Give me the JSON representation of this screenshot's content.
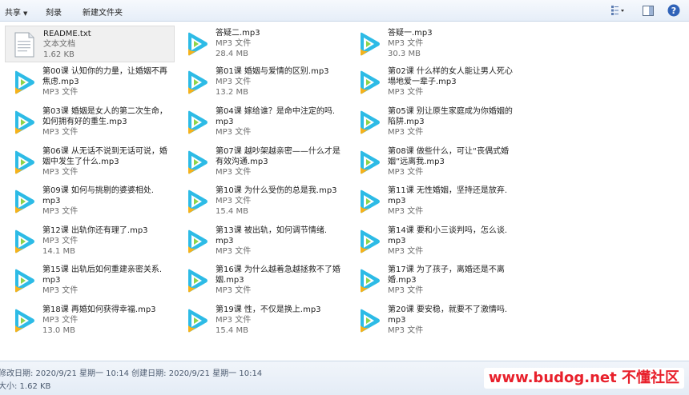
{
  "toolbar": {
    "share_label": "共享",
    "burn_label": "刻录",
    "new_folder_label": "新建文件夹",
    "view_options_icon": "view-list-icon",
    "preview_pane_icon": "preview-pane-icon",
    "help_icon": "help-icon"
  },
  "files": [
    {
      "name": "README.txt",
      "type": "文本文档",
      "size": "1.62 KB",
      "icon": "text-document-icon"
    },
    {
      "name": "答疑二.mp3",
      "type": "MP3 文件",
      "size": "28.4 MB",
      "icon": "media-player-icon"
    },
    {
      "name": "答疑一.mp3",
      "type": "MP3 文件",
      "size": "30.3 MB",
      "icon": "media-player-icon"
    },
    {
      "name": "第00课 认知你的力量，让婚姻不再\n焦虑.mp3",
      "type": "MP3 文件",
      "size": "",
      "icon": "media-player-icon"
    },
    {
      "name": "第01课 婚姻与爱情的区别.mp3",
      "type": "MP3 文件",
      "size": "13.2 MB",
      "icon": "media-player-icon"
    },
    {
      "name": "第02课 什么样的女人能让男人死心\n塌地爱一辈子.mp3",
      "type": "MP3 文件",
      "size": "",
      "icon": "media-player-icon"
    },
    {
      "name": "第03课 婚姻是女人的第二次生命，\n如何拥有好的重生.mp3",
      "type": "MP3 文件",
      "size": "",
      "icon": "media-player-icon"
    },
    {
      "name": "第04课 嫁给谁？是命中注定的吗.\nmp3",
      "type": "MP3 文件",
      "size": "",
      "icon": "media-player-icon"
    },
    {
      "name": "第05课 别让原生家庭成为你婚姻的\n陷阱.mp3",
      "type": "MP3 文件",
      "size": "",
      "icon": "media-player-icon"
    },
    {
      "name": "第06课 从无话不说到无话可说，婚\n姻中发生了什么.mp3",
      "type": "MP3 文件",
      "size": "",
      "icon": "media-player-icon"
    },
    {
      "name": "第07课 越吵架越亲密——什么才是\n有效沟通.mp3",
      "type": "MP3 文件",
      "size": "",
      "icon": "media-player-icon"
    },
    {
      "name": "第08课 做些什么，可让“丧偶式婚\n姻”远离我.mp3",
      "type": "MP3 文件",
      "size": "",
      "icon": "media-player-icon"
    },
    {
      "name": "第09课 如何与挑剔的婆婆相处.\nmp3",
      "type": "MP3 文件",
      "size": "",
      "icon": "media-player-icon"
    },
    {
      "name": "第10课 为什么受伤的总是我.mp3",
      "type": "MP3 文件",
      "size": "15.4 MB",
      "icon": "media-player-icon"
    },
    {
      "name": "第11课 无性婚姻，坚持还是放弃.\nmp3",
      "type": "MP3 文件",
      "size": "",
      "icon": "media-player-icon"
    },
    {
      "name": "第12课 出轨你还有理了.mp3",
      "type": "MP3 文件",
      "size": "14.1 MB",
      "icon": "media-player-icon"
    },
    {
      "name": "第13课 被出轨，如何调节情绪.\nmp3",
      "type": "MP3 文件",
      "size": "",
      "icon": "media-player-icon"
    },
    {
      "name": "第14课 要和小三谈判吗，怎么谈.\nmp3",
      "type": "MP3 文件",
      "size": "",
      "icon": "media-player-icon"
    },
    {
      "name": "第15课 出轨后如何重建亲密关系.\nmp3",
      "type": "MP3 文件",
      "size": "",
      "icon": "media-player-icon"
    },
    {
      "name": "第16课 为什么越着急越拯救不了婚\n姻.mp3",
      "type": "MP3 文件",
      "size": "",
      "icon": "media-player-icon"
    },
    {
      "name": "第17课 为了孩子，离婚还是不离\n婚.mp3",
      "type": "MP3 文件",
      "size": "",
      "icon": "media-player-icon"
    },
    {
      "name": "第18课 再婚如何获得幸福.mp3",
      "type": "MP3 文件",
      "size": "13.0 MB",
      "icon": "media-player-icon"
    },
    {
      "name": "第19课 性，不仅是换上.mp3",
      "type": "MP3 文件",
      "size": "15.4 MB",
      "icon": "media-player-icon"
    },
    {
      "name": "第20课 要安稳，就要不了激情吗.\nmp3",
      "type": "MP3 文件",
      "size": "",
      "icon": "media-player-icon"
    }
  ],
  "status": {
    "line1": "修改日期: 2020/9/21 星期一 10:14 创建日期: 2020/9/21 星期一 10:14",
    "line2": "大小: 1.62 KB"
  },
  "watermark": {
    "text": "www.budog.net 不懂社区"
  },
  "colors": {
    "accent": "#3366cc",
    "watermark": "#e8202b",
    "selection": "#f0f0f0"
  }
}
